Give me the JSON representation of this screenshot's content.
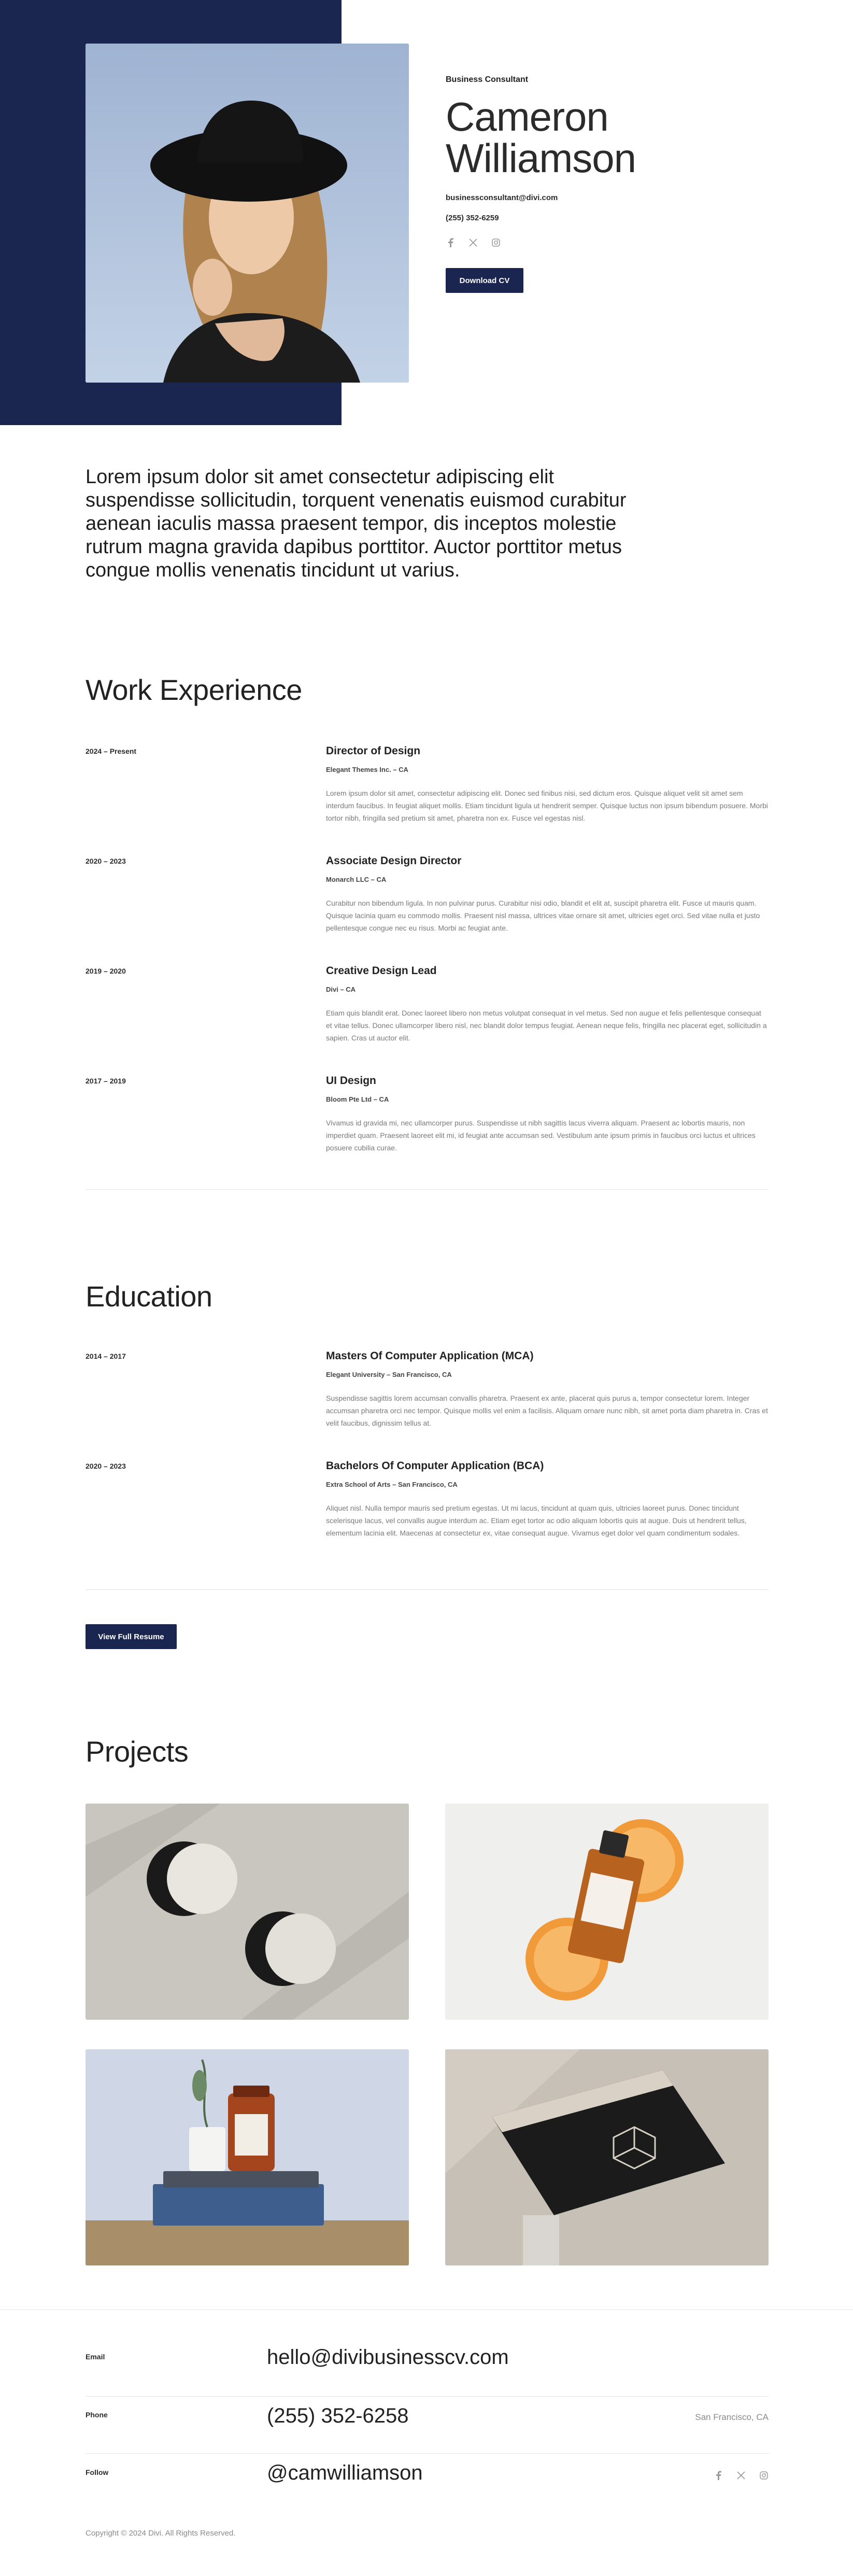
{
  "hero": {
    "role": "Business Consultant",
    "name_line1": "Cameron",
    "name_line2": "Williamson",
    "email": "businessconsultant@divi.com",
    "phone": "(255) 352-6259",
    "social_icons": [
      "facebook-icon",
      "x-twitter-icon",
      "instagram-icon"
    ],
    "cta_label": "Download CV",
    "accent_color": "#1a2550"
  },
  "intro": {
    "text": "Lorem ipsum dolor sit amet consectetur adipiscing elit suspendisse sollicitudin, torquent venenatis euismod curabitur aenean iaculis massa praesent tempor, dis inceptos molestie rutrum magna gravida dapibus porttitor. Auctor porttitor metus congue mollis venenatis tincidunt ut varius."
  },
  "work": {
    "title": "Work Experience",
    "items": [
      {
        "date": "2024 – Present",
        "title": "Director of Design",
        "company": "Elegant Themes Inc. – CA",
        "desc": "Lorem ipsum dolor sit amet, consectetur adipiscing elit. Donec sed finibus nisi, sed dictum eros. Quisque aliquet velit sit amet sem interdum faucibus. In feugiat aliquet mollis. Etiam tincidunt ligula ut hendrerit semper. Quisque luctus non ipsum bibendum posuere. Morbi tortor nibh, fringilla sed pretium sit amet, pharetra non ex. Fusce vel egestas nisl."
      },
      {
        "date": "2020 – 2023",
        "title": "Associate Design Director",
        "company": "Monarch LLC – CA",
        "desc": "Curabitur non bibendum ligula. In non pulvinar purus. Curabitur nisi odio, blandit et elit at, suscipit pharetra elit. Fusce ut mauris quam. Quisque lacinia quam eu commodo mollis. Praesent nisl massa, ultrices vitae ornare sit amet, ultricies eget orci. Sed vitae nulla et justo pellentesque congue nec eu risus. Morbi ac feugiat ante."
      },
      {
        "date": "2019 – 2020",
        "title": "Creative Design Lead",
        "company": "Divi – CA",
        "desc": "Etiam quis blandit erat. Donec laoreet libero non metus volutpat consequat in vel metus. Sed non augue et felis pellentesque consequat et vitae tellus. Donec ullamcorper libero nisl, nec blandit dolor tempus feugiat. Aenean neque felis, fringilla nec placerat eget, sollicitudin a sapien. Cras ut auctor elit."
      },
      {
        "date": "2017 – 2019",
        "title": "UI Design",
        "company": "Bloom Pte Ltd – CA",
        "desc": "Vivamus id gravida mi, nec ullamcorper purus. Suspendisse ut nibh sagittis lacus viverra aliquam. Praesent ac lobortis mauris, non imperdiet quam. Praesent laoreet elit mi, id feugiat ante accumsan sed. Vestibulum ante ipsum primis in faucibus orci luctus et ultrices posuere cubilia curae."
      }
    ]
  },
  "education": {
    "title": "Education",
    "items": [
      {
        "date": "2014 – 2017",
        "title": "Masters Of Computer Application (MCA)",
        "school": "Elegant University – San Francisco, CA",
        "desc": "Suspendisse sagittis lorem accumsan convallis pharetra. Praesent ex ante, placerat quis purus a, tempor consectetur lorem. Integer accumsan pharetra orci nec tempor. Quisque mollis vel enim a facilisis. Aliquam ornare nunc nibh, sit amet porta diam pharetra in. Cras et velit faucibus, dignissim tellus at."
      },
      {
        "date": "2020 – 2023",
        "title": "Bachelors Of Computer Application (BCA)",
        "school": "Extra School of Arts – San Francisco, CA",
        "desc": "Aliquet nisl. Nulla tempor mauris sed pretium egestas. Ut mi lacus, tincidunt at quam quis, ultricies laoreet purus. Donec tincidunt scelerisque lacus, vel convallis augue interdum ac. Etiam eget tortor ac odio aliquam lobortis quis at augue. Duis ut hendrerit tellus, elementum lacinia elit. Maecenas at consectetur ex, vitae consequat augue. Vivamus eget dolor vel quam condimentum sodales."
      }
    ],
    "button_label": "View Full Resume"
  },
  "projects": {
    "title": "Projects"
  },
  "footer": {
    "email_label": "Email",
    "email_value": "hello@divibusinesscv.com",
    "phone_label": "Phone",
    "phone_value": "(255) 352-6258",
    "location": "San Francisco, CA",
    "follow_label": "Follow",
    "follow_value": "@camwilliamson",
    "social_icons": [
      "facebook-icon",
      "x-twitter-icon",
      "instagram-icon"
    ],
    "copyright": "Copyright © 2024 Divi. All Rights Reserved."
  }
}
